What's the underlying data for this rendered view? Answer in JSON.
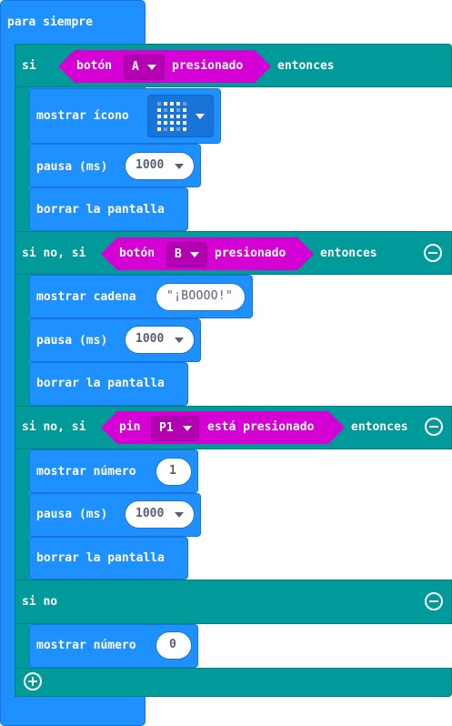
{
  "forever": {
    "label": "para siempre"
  },
  "if_block": {
    "if_label": "si",
    "then_label": "entonces",
    "condition": {
      "label": "botón",
      "value": "A",
      "suffix": "presionado"
    },
    "body": {
      "show_icon": {
        "label": "mostrar ícono"
      },
      "pause": {
        "label": "pausa (ms)",
        "value": "1000"
      },
      "clear": {
        "label": "borrar la pantalla"
      }
    }
  },
  "else_if_1": {
    "label": "si no, si",
    "then_label": "entonces",
    "condition": {
      "label": "botón",
      "value": "B",
      "suffix": "presionado"
    },
    "body": {
      "show_string": {
        "label": "mostrar cadena",
        "value": "\"¡BOOOO!\""
      },
      "pause": {
        "label": "pausa (ms)",
        "value": "1000"
      },
      "clear": {
        "label": "borrar la pantalla"
      }
    }
  },
  "else_if_2": {
    "label": "si no, si",
    "then_label": "entonces",
    "condition": {
      "label": "pin",
      "value": "P1",
      "suffix": "está presionado"
    },
    "body": {
      "show_number": {
        "label": "mostrar número",
        "value": "1"
      },
      "pause": {
        "label": "pausa (ms)",
        "value": "1000"
      },
      "clear": {
        "label": "borrar la pantalla"
      }
    }
  },
  "else_block": {
    "label": "si no",
    "body": {
      "show_number": {
        "label": "mostrar número",
        "value": "0"
      }
    }
  },
  "colors": {
    "basic": "#1e90ff",
    "logic": "#009a9a",
    "input": "#d400d4",
    "input_dark": "#b300b3"
  }
}
